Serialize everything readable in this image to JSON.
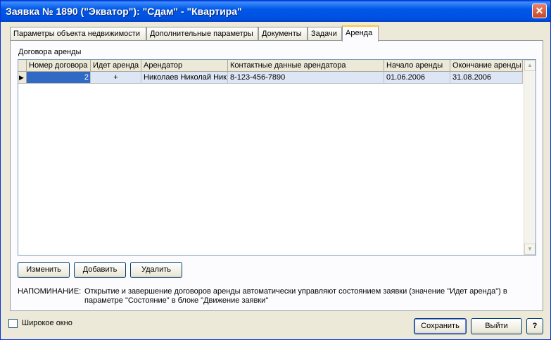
{
  "window": {
    "title": "Заявка № 1890 (\"Экватор\"): \"Сдам\" - \"Квартира\"",
    "close_glyph": "✕"
  },
  "tabs": [
    {
      "label": "Параметры объекта недвижимости",
      "active": false
    },
    {
      "label": "Дополнительные параметры",
      "active": false
    },
    {
      "label": "Документы",
      "active": false
    },
    {
      "label": "Задачи",
      "active": false
    },
    {
      "label": "Аренда",
      "active": true
    }
  ],
  "lease": {
    "group_label": "Договора аренды",
    "columns": [
      "Номер договора",
      "Идет аренда",
      "Арендатор",
      "Контактные данные арендатора",
      "Начало аренды",
      "Окончание аренды"
    ],
    "rows": [
      {
        "contract_no": "2",
        "active": "+",
        "tenant": "Николаев Николай Ник",
        "contacts": "8-123-456-7890",
        "start": "01.06.2006",
        "end": "31.08.2006"
      }
    ],
    "row_indicator": "▶"
  },
  "buttons": {
    "edit": "Изменить",
    "add": "Добавить",
    "delete": "Удалить"
  },
  "note": {
    "label": "НАПОМИНАНИЕ:",
    "line1": "Открытие и завершение договоров аренды автоматически управляют состоянием заявки (значение \"Идет аренда\") в",
    "line2": "параметре \"Состояние\" в блоке \"Движение заявки\""
  },
  "footer": {
    "wide_window_label": "Широкое окно",
    "save": "Сохранить",
    "exit": "Выйти",
    "help": "?"
  },
  "scroll": {
    "up": "▲",
    "down": "▼"
  }
}
